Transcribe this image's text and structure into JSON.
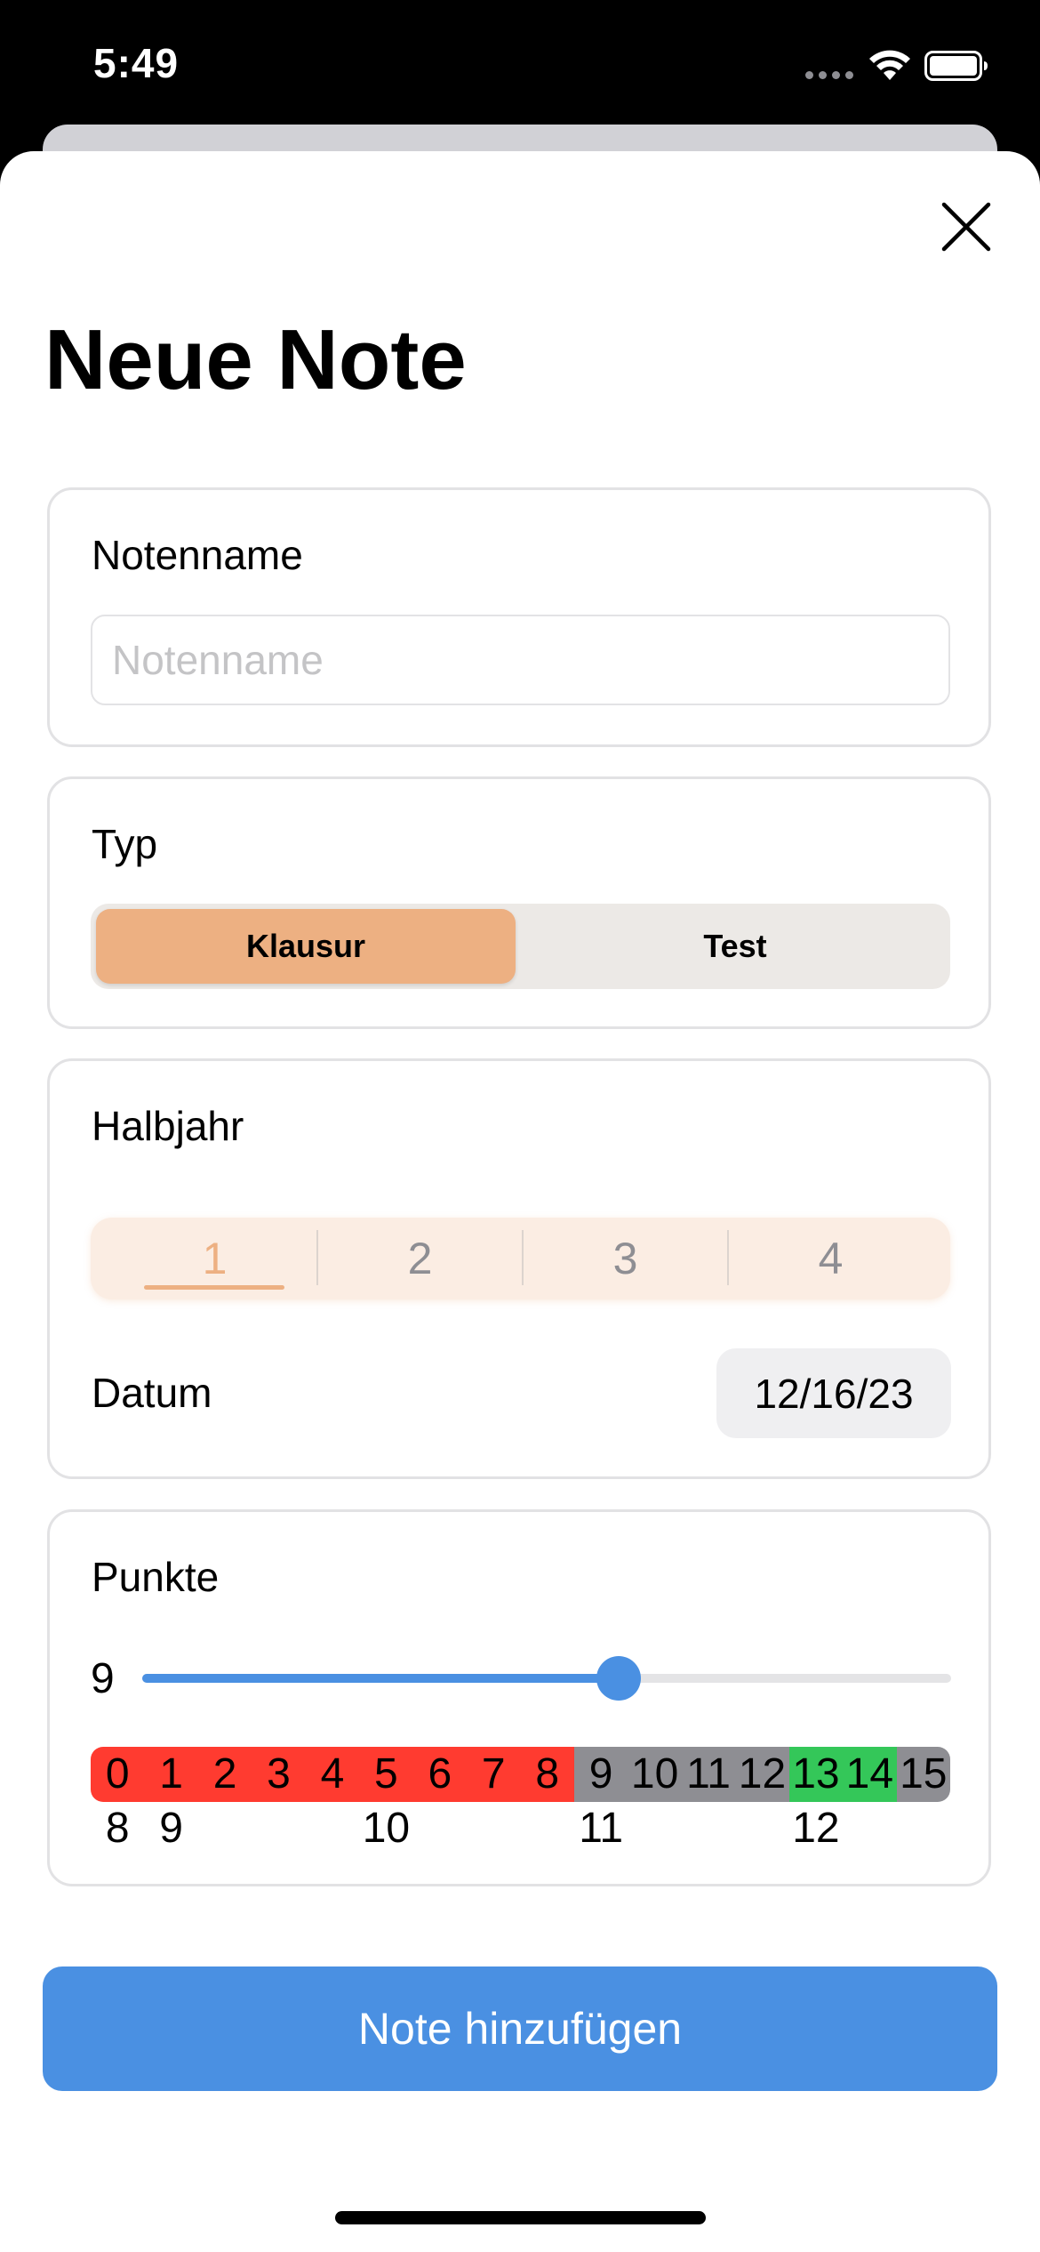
{
  "status_bar": {
    "time": "5:49"
  },
  "form": {
    "title": "Neue Note",
    "name_section": {
      "label": "Notenname",
      "value": "",
      "placeholder": "Notenname"
    },
    "type_section": {
      "label": "Typ",
      "options": [
        "Klausur",
        "Test"
      ],
      "selected": "Klausur"
    },
    "semester_section": {
      "label": "Halbjahr",
      "options": [
        "1",
        "2",
        "3",
        "4"
      ],
      "selected": "1",
      "date_label": "Datum",
      "date_value": "12/16/23"
    },
    "points_section": {
      "label": "Punkte",
      "value": "9",
      "slider_min": 0,
      "slider_max": 15,
      "slider_value": 9,
      "scale": [
        "0",
        "1",
        "2",
        "3",
        "4",
        "5",
        "6",
        "7",
        "8",
        "9",
        "10",
        "11",
        "12",
        "13",
        "14",
        "15"
      ],
      "scale_colors": {
        "fail": "#ff3b30",
        "neutral": "#8e8e93",
        "good": "#34c759"
      },
      "sub_values": [
        "8",
        "9",
        "10",
        "11",
        "12"
      ]
    },
    "submit_label": "Note hinzufügen"
  },
  "colors": {
    "accent_orange": "#edb082",
    "accent_blue": "#4a90e2"
  },
  "icons": {
    "close": "close-icon",
    "wifi": "wifi-icon",
    "battery": "battery-icon"
  }
}
